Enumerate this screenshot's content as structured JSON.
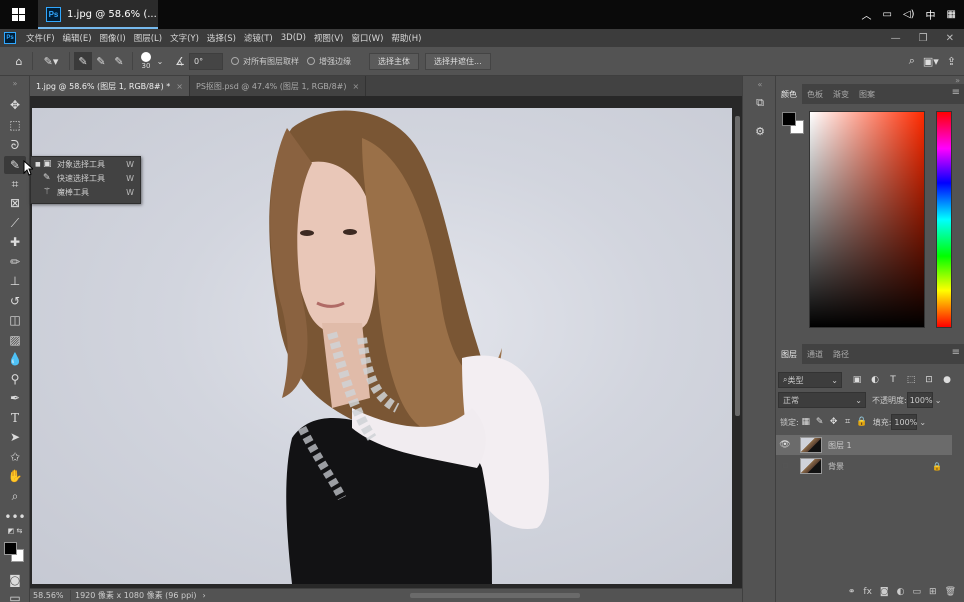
{
  "taskbar": {
    "app_title": "1.jpg @ 58.6% (...",
    "ime": "中",
    "tray_icons": [
      "chevron-up-icon",
      "network-icon",
      "volume-icon",
      "ime-icon",
      "keyboard-grid-icon"
    ]
  },
  "menubar": {
    "items": [
      "文件(F)",
      "编辑(E)",
      "图像(I)",
      "图层(L)",
      "文字(Y)",
      "选择(S)",
      "滤镜(T)",
      "3D(D)",
      "视图(V)",
      "窗口(W)",
      "帮助(H)"
    ],
    "logo": "Ps"
  },
  "optbar": {
    "brush_size": "30",
    "angle": "0°",
    "sample_all_layers": "对所有图层取样",
    "enhance_edge": "增强边缘",
    "select_subject": "选择主体",
    "select_and_mask": "选择并遮住..."
  },
  "flyout": {
    "items": [
      {
        "label": "对象选择工具",
        "key": "W"
      },
      {
        "label": "快速选择工具",
        "key": "W"
      },
      {
        "label": "魔棒工具",
        "key": "W"
      }
    ]
  },
  "doctabs": [
    {
      "label": "1.jpg @ 58.6% (图层 1, RGB/8#) *",
      "close": "×"
    },
    {
      "label": "PS抠图.psd @ 47.4% (图层 1, RGB/8#)",
      "close": "×"
    }
  ],
  "statusbar": {
    "zoom": "58.56%",
    "info": "1920 像素 x 1080 像素 (96 ppi)",
    "arrow": "›"
  },
  "color_panel": {
    "tabs": [
      "颜色",
      "色板",
      "渐变",
      "图案"
    ],
    "foreground": "#000000",
    "background": "#ffffff"
  },
  "layers_panel": {
    "tabs": [
      "图层",
      "通道",
      "路径"
    ],
    "filter": "类型",
    "blend_mode": "正常",
    "opacity_label": "不透明度:",
    "opacity": "100%",
    "lock_label": "锁定:",
    "fill_label": "填充:",
    "fill": "100%",
    "layers": [
      {
        "name": "图层 1",
        "visible": true,
        "selected": true
      },
      {
        "name": "背景",
        "visible": false,
        "selected": false,
        "locked": true
      }
    ]
  }
}
